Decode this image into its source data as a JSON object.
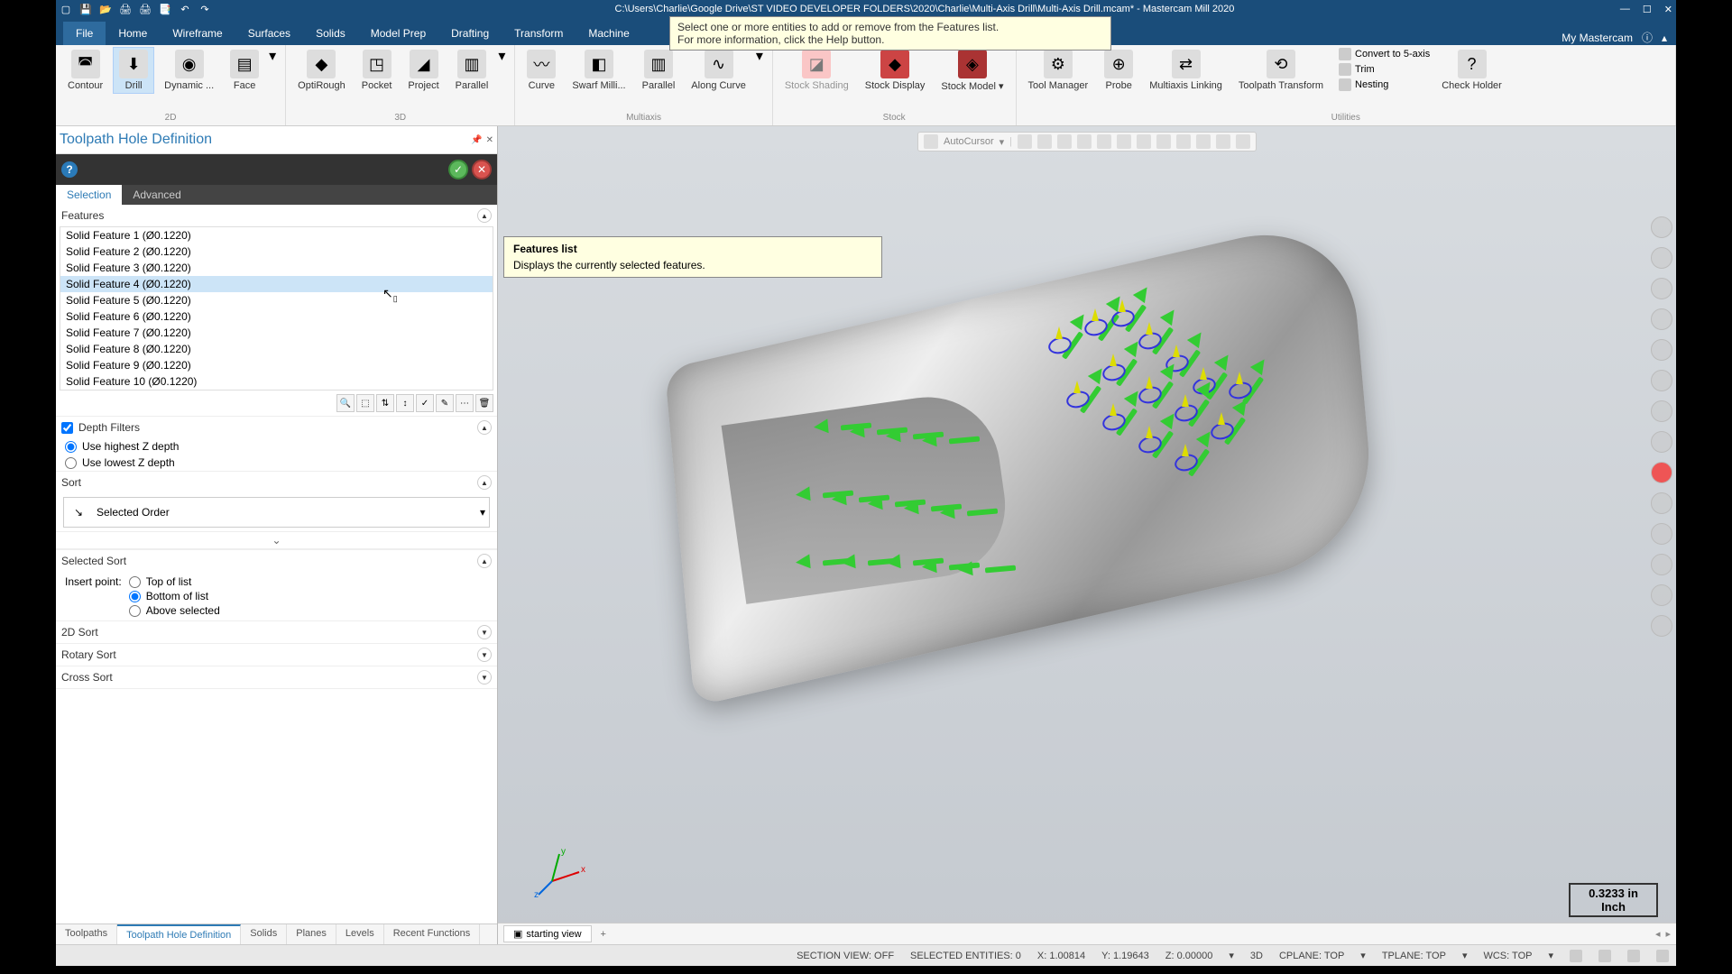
{
  "title_bar": {
    "file_path": "C:\\Users\\Charlie\\Google Drive\\ST VIDEO DEVELOPER FOLDERS\\2020\\Charlie\\Multi-Axis Drill\\Multi-Axis Drill.mcam* - Mastercam Mill 2020"
  },
  "help_banner": {
    "line1": "Select one or more entities to add or remove from the Features list.",
    "line2": "For more information, click the Help button."
  },
  "ribbon_tabs": [
    "File",
    "Home",
    "Wireframe",
    "Surfaces",
    "Solids",
    "Model Prep",
    "Drafting",
    "Transform",
    "Machine"
  ],
  "ribbon_right": {
    "my_mastercam": "My Mastercam"
  },
  "ribbon_groups": {
    "g2d": {
      "label": "2D",
      "items": [
        "Contour",
        "Drill",
        "Dynamic ...",
        "Face"
      ]
    },
    "g3d": {
      "label": "3D",
      "items": [
        "OptiRough",
        "Pocket",
        "Project",
        "Parallel"
      ]
    },
    "multiaxis": {
      "label": "Multiaxis",
      "items": [
        "Curve",
        "Swarf Milli...",
        "Parallel",
        "Along Curve"
      ]
    },
    "stock": {
      "label": "Stock",
      "items": [
        "Stock Shading",
        "Stock Display",
        "Stock Model ▾"
      ]
    },
    "utilities": {
      "label": "Utilities",
      "items": [
        "Tool Manager",
        "Probe",
        "Multiaxis Linking",
        "Toolpath Transform"
      ],
      "small": [
        "Convert to 5-axis",
        "Trim",
        "Nesting"
      ],
      "check": "Check Holder"
    }
  },
  "panel": {
    "title": "Toolpath Hole Definition",
    "sub_tabs": [
      "Selection",
      "Advanced"
    ],
    "features_label": "Features",
    "features": [
      "Solid Feature 1 (Ø0.1220)",
      "Solid Feature 2 (Ø0.1220)",
      "Solid Feature 3 (Ø0.1220)",
      "Solid Feature 4 (Ø0.1220)",
      "Solid Feature 5 (Ø0.1220)",
      "Solid Feature 6 (Ø0.1220)",
      "Solid Feature 7 (Ø0.1220)",
      "Solid Feature 8 (Ø0.1220)",
      "Solid Feature 9 (Ø0.1220)",
      "Solid Feature 10 (Ø0.1220)"
    ],
    "selected_feature_index": 3,
    "depth_filters": {
      "label": "Depth Filters",
      "opt1": "Use highest Z depth",
      "opt2": "Use lowest Z depth"
    },
    "sort": {
      "label": "Sort",
      "value": "Selected Order"
    },
    "selected_sort": {
      "label": "Selected Sort",
      "insert_point_label": "Insert point:",
      "opts": [
        "Top of list",
        "Bottom of list",
        "Above selected"
      ],
      "selected": 1
    },
    "sort_2d": "2D Sort",
    "rotary_sort": "Rotary Sort",
    "cross_sort": "Cross Sort"
  },
  "features_tooltip": {
    "title": "Features list",
    "body": "Displays the currently selected features."
  },
  "viewport": {
    "autocursor": "AutoCursor",
    "starting_view": "starting view",
    "scale_value": "0.3233 in",
    "scale_unit": "Inch"
  },
  "panel_bottom_tabs": [
    "Toolpaths",
    "Toolpath Hole Definition",
    "Solids",
    "Planes",
    "Levels",
    "Recent Functions"
  ],
  "status": {
    "section_view": "SECTION VIEW: OFF",
    "selected_entities": "SELECTED ENTITIES: 0",
    "x": "X: 1.00814",
    "y": "Y: 1.19643",
    "z": "Z: 0.00000",
    "mode": "3D",
    "cplane": "CPLANE: TOP",
    "tplane": "TPLANE: TOP",
    "wcs": "WCS: TOP"
  }
}
